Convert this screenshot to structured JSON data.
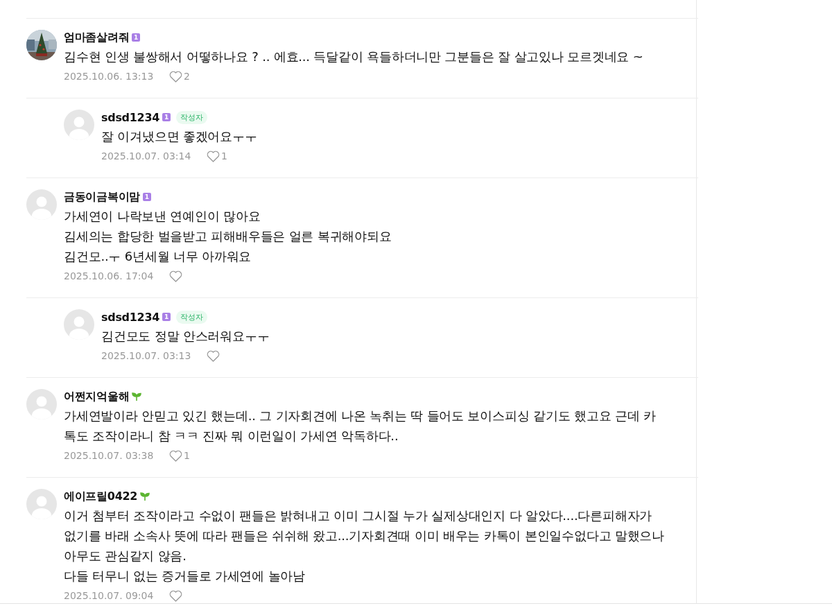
{
  "comments": [
    {
      "reply": false,
      "photo_avatar": true,
      "author": "엄마좀살려줘",
      "badge": {
        "kind": "level",
        "text": "1"
      },
      "is_writer": false,
      "lines": [
        "김수현 인생 불쌍해서 어떻하나요 ? .. 에효... 득달같이 욕들하더니만 그분들은 잘 살고있나 모르겟네요 ~"
      ],
      "date": "2025.10.06. 13:13",
      "likes": "2"
    },
    {
      "reply": true,
      "photo_avatar": false,
      "author": "sdsd1234",
      "badge": {
        "kind": "level",
        "text": "1"
      },
      "is_writer": true,
      "writer_tag": "작성자",
      "lines": [
        "잘 이겨냈으면 좋겠어요ㅜㅜ"
      ],
      "date": "2025.10.07. 03:14",
      "likes": "1"
    },
    {
      "reply": false,
      "photo_avatar": false,
      "author": "금동이금복이맘",
      "badge": {
        "kind": "level",
        "text": "1"
      },
      "is_writer": false,
      "lines": [
        "가세연이 나락보낸 연예인이 많아요",
        "김세의는 합당한 벌을받고 피해배우들은 얼른 복귀해야되요",
        "김건모..ㅜ 6년세월 너무 아까워요"
      ],
      "date": "2025.10.06. 17:04"
    },
    {
      "reply": true,
      "photo_avatar": false,
      "author": "sdsd1234",
      "badge": {
        "kind": "level",
        "text": "1"
      },
      "is_writer": true,
      "writer_tag": "작성자",
      "lines": [
        "김건모도 정말 안스러워요ㅜㅜ"
      ],
      "date": "2025.10.07. 03:13"
    },
    {
      "reply": false,
      "photo_avatar": false,
      "author": "어쩐지억울해",
      "badge": {
        "kind": "sprout"
      },
      "is_writer": false,
      "lines": [
        "가세연발이라 안믿고 있긴 했는데.. 그 기자회견에 나온 녹취는 딱 들어도 보이스피싱 같기도 했고요 근데 카",
        "톡도 조작이라니 참 ㅋㅋ 진짜 뭐 이런일이 가세연 악독하다.."
      ],
      "date": "2025.10.07. 03:38",
      "likes": "1"
    },
    {
      "reply": false,
      "photo_avatar": false,
      "author": "에이프릴0422",
      "badge": {
        "kind": "sprout"
      },
      "is_writer": false,
      "lines": [
        "이거 첨부터 조작이라고 수없이 팬들은 밝혀내고 이미 그시절 누가 실제상대인지 다 알았다....다른피해자가",
        "없기를 바래 소속사 뜻에 따라 팬들은 쉬쉬해 왔고...기자회견때 이미 배우는 카톡이 본인일수없다고 말했으나",
        "아무도 관심같지 않음.",
        "다들 터무니 없는 증거들로 가세연에 놀아남"
      ],
      "date": "2025.10.07. 09:04"
    }
  ]
}
